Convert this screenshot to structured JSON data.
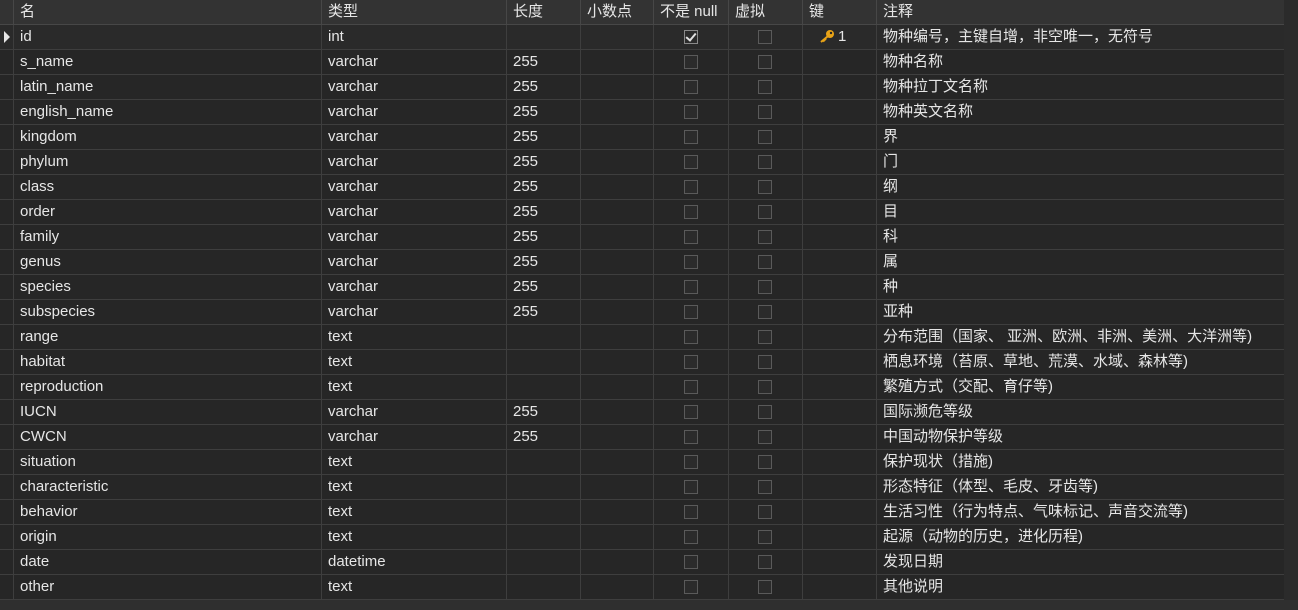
{
  "headers": {
    "name": "名",
    "type": "类型",
    "length": "长度",
    "decimals": "小数点",
    "not_null": "不是 null",
    "virtual": "虚拟",
    "key": "键",
    "comment": "注释"
  },
  "colors": {
    "background": "#262626",
    "header_bg": "#333333",
    "grid_line": "#3e3e3e",
    "text": "#e6e6e6",
    "key_icon": "#e8a317"
  },
  "rows": [
    {
      "name": "id",
      "type": "int",
      "length": "",
      "decimals": "",
      "not_null": true,
      "virtual": false,
      "key": "1",
      "key_icon": "key-icon",
      "comment": "物种编号，主键自增，非空唯一，无符号",
      "selected": true
    },
    {
      "name": "s_name",
      "type": "varchar",
      "length": "255",
      "decimals": "",
      "not_null": false,
      "virtual": false,
      "key": "",
      "comment": "物种名称"
    },
    {
      "name": "latin_name",
      "type": "varchar",
      "length": "255",
      "decimals": "",
      "not_null": false,
      "virtual": false,
      "key": "",
      "comment": "物种拉丁文名称"
    },
    {
      "name": "english_name",
      "type": "varchar",
      "length": "255",
      "decimals": "",
      "not_null": false,
      "virtual": false,
      "key": "",
      "comment": "物种英文名称"
    },
    {
      "name": "kingdom",
      "type": "varchar",
      "length": "255",
      "decimals": "",
      "not_null": false,
      "virtual": false,
      "key": "",
      "comment": "界"
    },
    {
      "name": "phylum",
      "type": "varchar",
      "length": "255",
      "decimals": "",
      "not_null": false,
      "virtual": false,
      "key": "",
      "comment": "门"
    },
    {
      "name": "class",
      "type": "varchar",
      "length": "255",
      "decimals": "",
      "not_null": false,
      "virtual": false,
      "key": "",
      "comment": "纲"
    },
    {
      "name": "order",
      "type": "varchar",
      "length": "255",
      "decimals": "",
      "not_null": false,
      "virtual": false,
      "key": "",
      "comment": "目"
    },
    {
      "name": "family",
      "type": "varchar",
      "length": "255",
      "decimals": "",
      "not_null": false,
      "virtual": false,
      "key": "",
      "comment": "科"
    },
    {
      "name": "genus",
      "type": "varchar",
      "length": "255",
      "decimals": "",
      "not_null": false,
      "virtual": false,
      "key": "",
      "comment": "属"
    },
    {
      "name": "species",
      "type": "varchar",
      "length": "255",
      "decimals": "",
      "not_null": false,
      "virtual": false,
      "key": "",
      "comment": "种"
    },
    {
      "name": "subspecies",
      "type": "varchar",
      "length": "255",
      "decimals": "",
      "not_null": false,
      "virtual": false,
      "key": "",
      "comment": "亚种"
    },
    {
      "name": "range",
      "type": "text",
      "length": "",
      "decimals": "",
      "not_null": false,
      "virtual": false,
      "key": "",
      "comment": "分布范围（国家、 亚洲、欧洲、非洲、美洲、大洋洲等)"
    },
    {
      "name": "habitat",
      "type": "text",
      "length": "",
      "decimals": "",
      "not_null": false,
      "virtual": false,
      "key": "",
      "comment": "栖息环境（苔原、草地、荒漠、水域、森林等)"
    },
    {
      "name": "reproduction",
      "type": "text",
      "length": "",
      "decimals": "",
      "not_null": false,
      "virtual": false,
      "key": "",
      "comment": "繁殖方式（交配、育仔等)"
    },
    {
      "name": "IUCN",
      "type": "varchar",
      "length": "255",
      "decimals": "",
      "not_null": false,
      "virtual": false,
      "key": "",
      "comment": "国际濒危等级"
    },
    {
      "name": "CWCN",
      "type": "varchar",
      "length": "255",
      "decimals": "",
      "not_null": false,
      "virtual": false,
      "key": "",
      "comment": "中国动物保护等级"
    },
    {
      "name": "situation",
      "type": "text",
      "length": "",
      "decimals": "",
      "not_null": false,
      "virtual": false,
      "key": "",
      "comment": "保护现状（措施)"
    },
    {
      "name": "characteristic",
      "type": "text",
      "length": "",
      "decimals": "",
      "not_null": false,
      "virtual": false,
      "key": "",
      "comment": "形态特征（体型、毛皮、牙齿等)"
    },
    {
      "name": "behavior",
      "type": "text",
      "length": "",
      "decimals": "",
      "not_null": false,
      "virtual": false,
      "key": "",
      "comment": "生活习性（行为特点、气味标记、声音交流等)"
    },
    {
      "name": "origin",
      "type": "text",
      "length": "",
      "decimals": "",
      "not_null": false,
      "virtual": false,
      "key": "",
      "comment": "起源（动物的历史，进化历程)"
    },
    {
      "name": "date",
      "type": "datetime",
      "length": "",
      "decimals": "",
      "not_null": false,
      "virtual": false,
      "key": "",
      "comment": "发现日期"
    },
    {
      "name": "other",
      "type": "text",
      "length": "",
      "decimals": "",
      "not_null": false,
      "virtual": false,
      "key": "",
      "comment": "其他说明"
    }
  ]
}
